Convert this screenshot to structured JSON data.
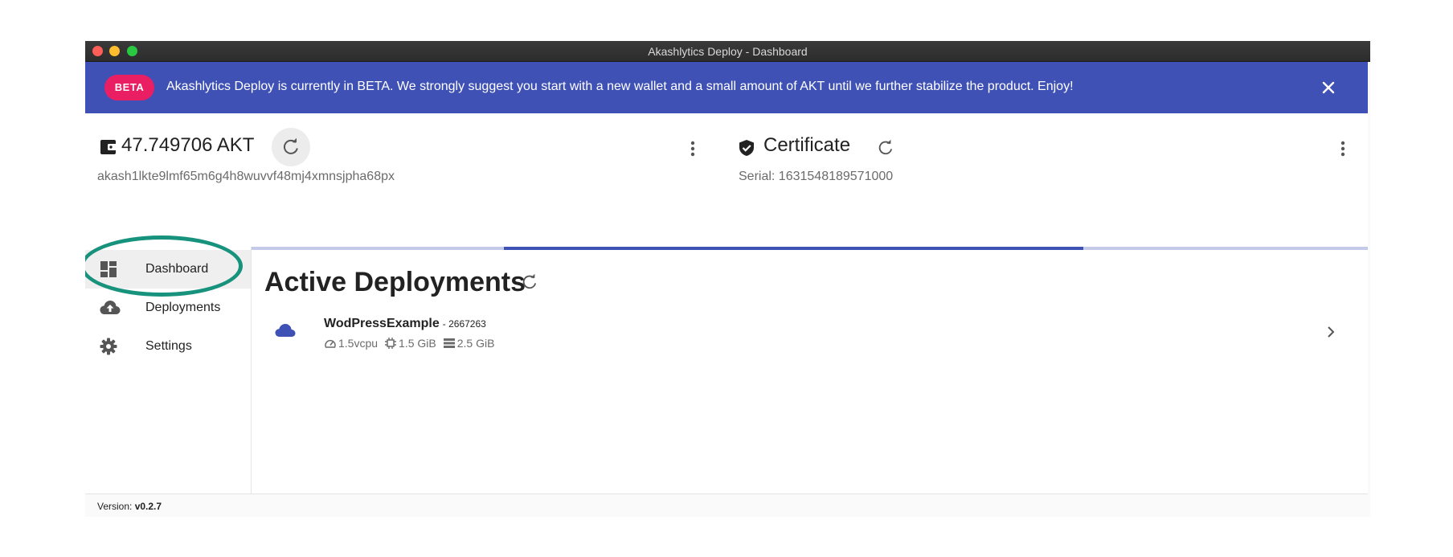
{
  "window": {
    "title": "Akashlytics Deploy - Dashboard"
  },
  "banner": {
    "badge": "BETA",
    "message": "Akashlytics Deploy is currently in BETA. We strongly suggest you start with a new wallet and a small amount of AKT until we further stabilize the product. Enjoy!",
    "color": "#3f51b5",
    "badge_color": "#e91e63"
  },
  "wallet": {
    "balance": "47.749706 AKT",
    "address": "akash1lkte9lmf65m6g4h8wuvvf48mj4xmnsjpha68px",
    "icon": "wallet-icon"
  },
  "certificate": {
    "title": "Certificate",
    "serial": "Serial: 1631548189571000",
    "icon": "verified-shield-icon"
  },
  "sidebar": {
    "items": [
      {
        "label": "Dashboard",
        "icon": "dashboard-icon",
        "active": true
      },
      {
        "label": "Deployments",
        "icon": "cloud-upload-icon",
        "active": false
      },
      {
        "label": "Settings",
        "icon": "gear-icon",
        "active": false
      }
    ],
    "highlight_color": "#17927d"
  },
  "main": {
    "title": "Active Deployments",
    "loading_bar": {
      "start": 0.226,
      "end": 0.745
    },
    "deployments": [
      {
        "name": "WodPressExample",
        "dseq": "- 2667263",
        "cpu": "1.5vcpu",
        "memory": "1.5 GiB",
        "storage": "2.5 GiB"
      }
    ]
  },
  "footer": {
    "version_label": "Version: ",
    "version": "v0.2.7"
  }
}
